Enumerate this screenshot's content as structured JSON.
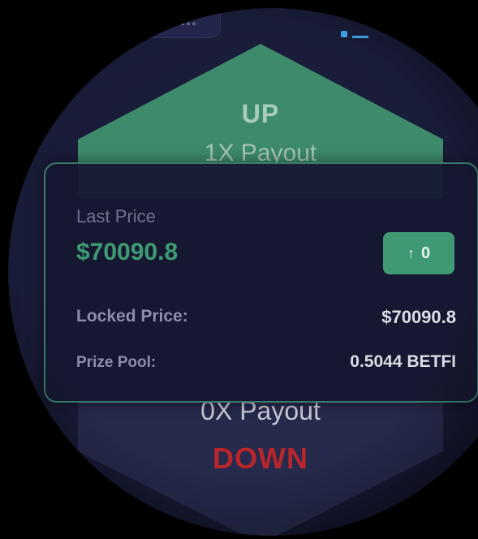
{
  "top": {
    "chip_text": "…"
  },
  "up_section": {
    "label": "UP",
    "payout": "1X Payout"
  },
  "card": {
    "last_price_label": "Last Price",
    "last_price_value": "$70090.8",
    "change_badge": {
      "icon": "arrow-up-icon",
      "value": "0"
    },
    "locked_price_label": "Locked Price:",
    "locked_price_value": "$70090.8",
    "prize_pool_label": "Prize Pool:",
    "prize_pool_value": "0.5044 BETFI"
  },
  "down_section": {
    "payout": "0X Payout",
    "label": "DOWN"
  },
  "colors": {
    "up_green": "#3e8b6c",
    "price_green": "#3e9a73",
    "down_red": "#b6262c",
    "card_bg": "#161830",
    "card_border": "#3a7a6c",
    "background": "#191c38"
  }
}
